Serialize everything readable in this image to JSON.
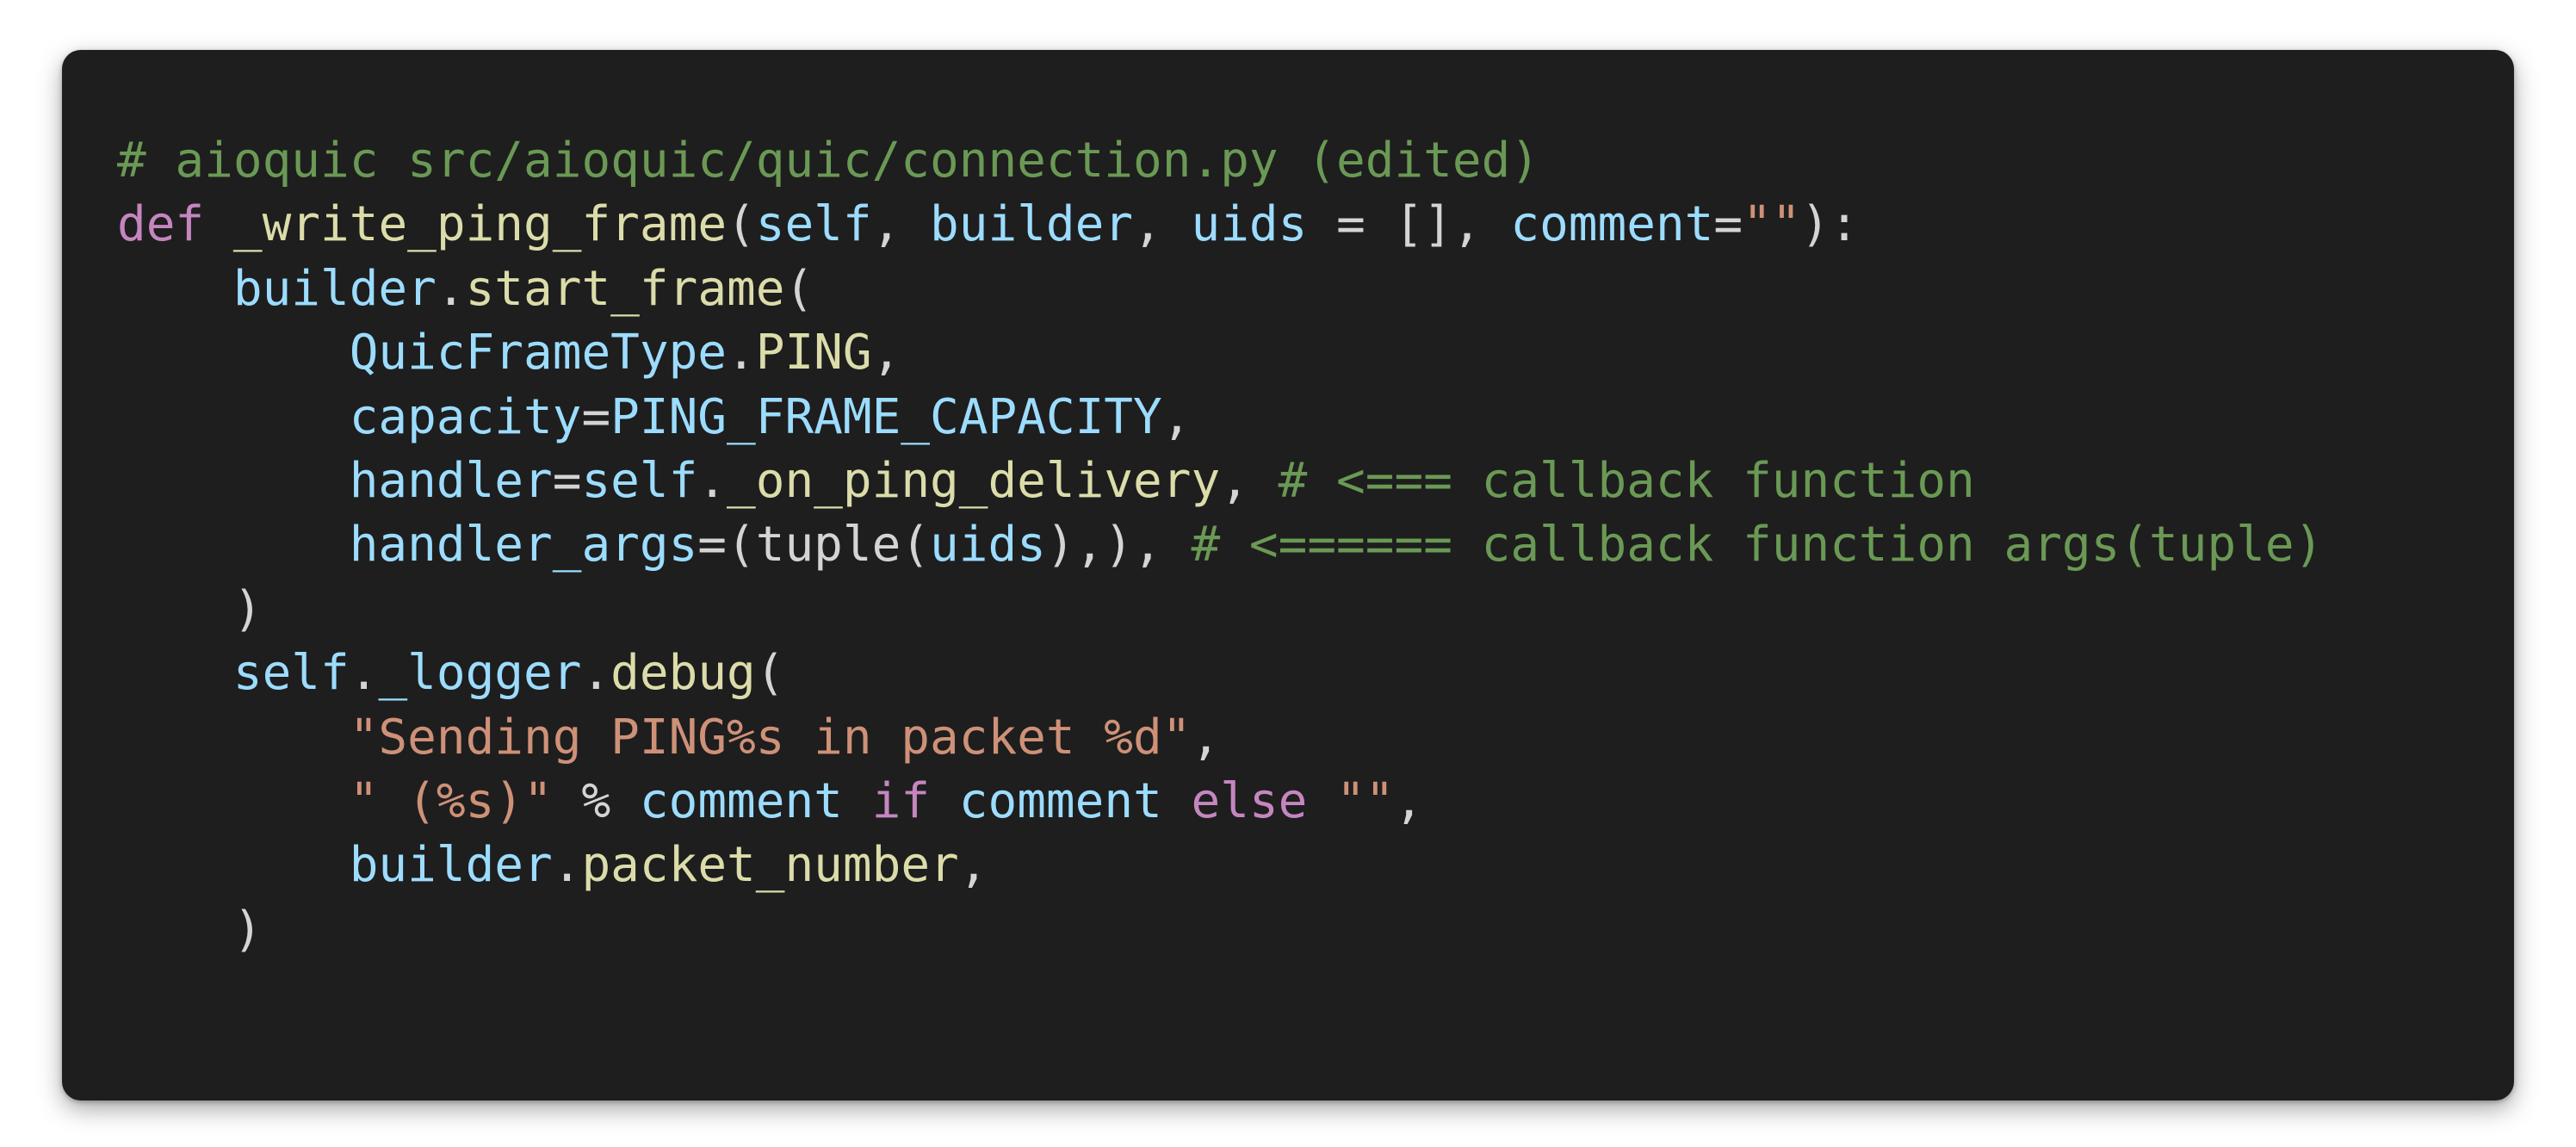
{
  "colors": {
    "background": "#1e1e1e",
    "comment": "#6a9955",
    "keyword": "#c586c0",
    "function": "#dcdcaa",
    "variable": "#9cdcfe",
    "string": "#ce9178",
    "plain": "#d4d4d4"
  },
  "code": {
    "lines": [
      [
        {
          "t": "# aioquic src/aioquic/quic/connection.py (edited)",
          "k": "comment"
        }
      ],
      [
        {
          "t": "def",
          "k": "keyword"
        },
        {
          "t": " ",
          "k": "plain"
        },
        {
          "t": "_write_ping_frame",
          "k": "func"
        },
        {
          "t": "(",
          "k": "plain"
        },
        {
          "t": "self",
          "k": "var"
        },
        {
          "t": ", ",
          "k": "plain"
        },
        {
          "t": "builder",
          "k": "var"
        },
        {
          "t": ", ",
          "k": "plain"
        },
        {
          "t": "uids",
          "k": "var"
        },
        {
          "t": " = [], ",
          "k": "plain"
        },
        {
          "t": "comment",
          "k": "var"
        },
        {
          "t": "=",
          "k": "plain"
        },
        {
          "t": "\"\"",
          "k": "str"
        },
        {
          "t": "):",
          "k": "plain"
        }
      ],
      [
        {
          "t": "    ",
          "k": "plain"
        },
        {
          "t": "builder",
          "k": "var"
        },
        {
          "t": ".",
          "k": "plain"
        },
        {
          "t": "start_frame",
          "k": "func"
        },
        {
          "t": "(",
          "k": "plain"
        }
      ],
      [
        {
          "t": "        ",
          "k": "plain"
        },
        {
          "t": "QuicFrameType",
          "k": "var"
        },
        {
          "t": ".",
          "k": "plain"
        },
        {
          "t": "PING",
          "k": "func"
        },
        {
          "t": ",",
          "k": "plain"
        }
      ],
      [
        {
          "t": "        ",
          "k": "plain"
        },
        {
          "t": "capacity",
          "k": "var"
        },
        {
          "t": "=",
          "k": "plain"
        },
        {
          "t": "PING_FRAME_CAPACITY",
          "k": "var"
        },
        {
          "t": ",",
          "k": "plain"
        }
      ],
      [
        {
          "t": "        ",
          "k": "plain"
        },
        {
          "t": "handler",
          "k": "var"
        },
        {
          "t": "=",
          "k": "plain"
        },
        {
          "t": "self",
          "k": "var"
        },
        {
          "t": ".",
          "k": "plain"
        },
        {
          "t": "_on_ping_delivery",
          "k": "func"
        },
        {
          "t": ", ",
          "k": "plain"
        },
        {
          "t": "# <=== callback function",
          "k": "comment"
        }
      ],
      [
        {
          "t": "        ",
          "k": "plain"
        },
        {
          "t": "handler_args",
          "k": "var"
        },
        {
          "t": "=(",
          "k": "plain"
        },
        {
          "t": "tuple",
          "k": "plain"
        },
        {
          "t": "(",
          "k": "plain"
        },
        {
          "t": "uids",
          "k": "var"
        },
        {
          "t": "),), ",
          "k": "plain"
        },
        {
          "t": "# <====== callback function args(tuple)",
          "k": "comment"
        }
      ],
      [
        {
          "t": "    )",
          "k": "plain"
        }
      ],
      [
        {
          "t": "    ",
          "k": "plain"
        },
        {
          "t": "self",
          "k": "var"
        },
        {
          "t": ".",
          "k": "plain"
        },
        {
          "t": "_logger",
          "k": "var"
        },
        {
          "t": ".",
          "k": "plain"
        },
        {
          "t": "debug",
          "k": "func"
        },
        {
          "t": "(",
          "k": "plain"
        }
      ],
      [
        {
          "t": "        ",
          "k": "plain"
        },
        {
          "t": "\"Sending PING%s in packet %d\"",
          "k": "str"
        },
        {
          "t": ",",
          "k": "plain"
        }
      ],
      [
        {
          "t": "        ",
          "k": "plain"
        },
        {
          "t": "\" (%s)\"",
          "k": "str"
        },
        {
          "t": " % ",
          "k": "plain"
        },
        {
          "t": "comment",
          "k": "var"
        },
        {
          "t": " ",
          "k": "plain"
        },
        {
          "t": "if",
          "k": "keyword"
        },
        {
          "t": " ",
          "k": "plain"
        },
        {
          "t": "comment",
          "k": "var"
        },
        {
          "t": " ",
          "k": "plain"
        },
        {
          "t": "else",
          "k": "keyword"
        },
        {
          "t": " ",
          "k": "plain"
        },
        {
          "t": "\"\"",
          "k": "str"
        },
        {
          "t": ",",
          "k": "plain"
        }
      ],
      [
        {
          "t": "        ",
          "k": "plain"
        },
        {
          "t": "builder",
          "k": "var"
        },
        {
          "t": ".",
          "k": "plain"
        },
        {
          "t": "packet_number",
          "k": "func"
        },
        {
          "t": ",",
          "k": "plain"
        }
      ],
      [
        {
          "t": "    )",
          "k": "plain"
        }
      ]
    ]
  }
}
